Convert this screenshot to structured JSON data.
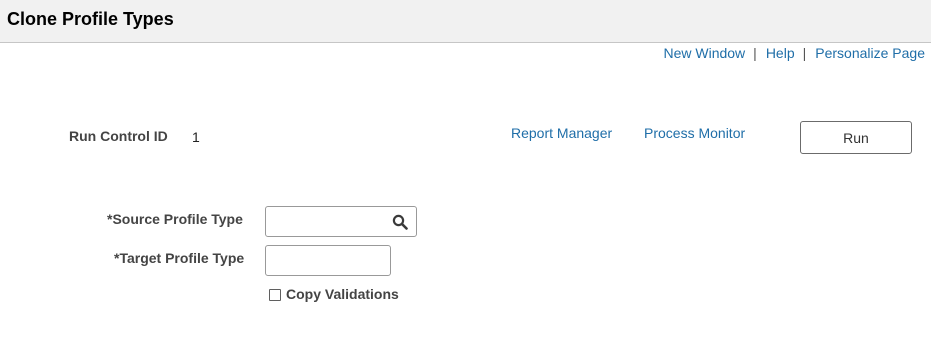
{
  "header": {
    "title": "Clone Profile Types"
  },
  "toplinks": [
    {
      "label": "New Window"
    },
    {
      "label": "Help"
    },
    {
      "label": "Personalize Page"
    }
  ],
  "toplinks_separator": "|",
  "run_control": {
    "label": "Run Control ID",
    "value": "1"
  },
  "links": {
    "report_manager": "Report Manager",
    "process_monitor": "Process Monitor"
  },
  "run_button": {
    "label": "Run"
  },
  "fields": {
    "source_profile_type": {
      "label": "*Source Profile Type",
      "value": "",
      "icon": "search-icon"
    },
    "target_profile_type": {
      "label": "*Target Profile Type",
      "value": ""
    }
  },
  "copy_validations": {
    "label": "Copy Validations",
    "checked": false
  },
  "colors": {
    "link": "#1f6ea8",
    "titlebar_bg": "#f1f1f1",
    "label_text": "#444444"
  }
}
